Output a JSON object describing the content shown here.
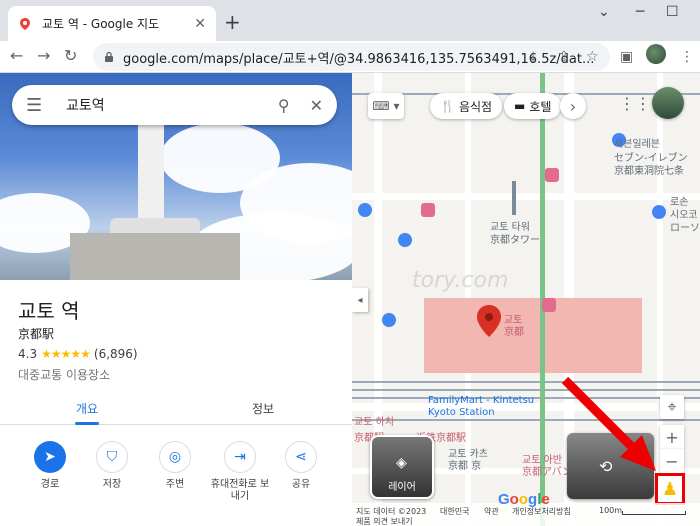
{
  "browser": {
    "tab_title": "교토 역 - Google 지도",
    "url": "google.com/maps/place/교토+역/@34.9863416,135.7563491,16.5z/dat..."
  },
  "search": {
    "query": "교토역"
  },
  "place": {
    "title": "교토 역",
    "native_name": "京都駅",
    "rating": "4.3",
    "stars": "★★★★★",
    "review_count": "(6,896)",
    "category": "대중교통 이용장소"
  },
  "tabs": [
    {
      "label": "개요",
      "active": true
    },
    {
      "label": "정보",
      "active": false
    }
  ],
  "actions": [
    {
      "label": "경로",
      "icon": "directions-icon"
    },
    {
      "label": "저장",
      "icon": "bookmark-icon"
    },
    {
      "label": "주변",
      "icon": "nearby-icon"
    },
    {
      "label": "휴대전화로 보내기",
      "icon": "send-to-phone-icon"
    },
    {
      "label": "공유",
      "icon": "share-icon"
    }
  ],
  "map": {
    "chips": {
      "restaurants": "음식점",
      "hotels": "호텔"
    },
    "labels": {
      "tower_ko": "교토 타워",
      "tower_ja": "京都タワー",
      "station_ko": "교토",
      "station_ja": "京都",
      "family_mart": "FamilyMart - Kintetsu",
      "kyoto_station_en": "Kyoto Station",
      "seven_eleven_ko": "세븐일레븐",
      "seven_eleven_ja": "セブン-イレブン",
      "seven_eleven_branch": "京都東洞院七条",
      "lawson_ko": "로손",
      "lawson_loc": "시오코",
      "lawson_ja": "ローソ",
      "kyoto_hachijo": "교토 하치",
      "kintetsu_kyoto": "近鉄京都駅",
      "kyoto_station_ja": "京都駅",
      "avanti_ko": "교토 아반",
      "avanti_ja": "京都アバン",
      "misc_ko": "교토 카츠",
      "misc_ja": "京都 京",
      "watermark": "tory.com"
    },
    "layer_label": "레이어",
    "footer": {
      "data": "지도 데이터 ©2023",
      "country": "대한민국",
      "terms": "약관",
      "privacy": "개인정보처리방침",
      "scale": "100m",
      "feedback": "제품 의견 보내기"
    }
  }
}
